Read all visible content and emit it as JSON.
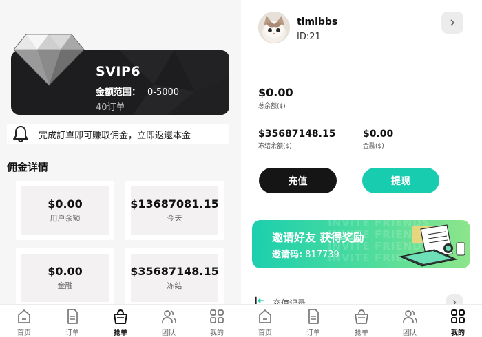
{
  "left": {
    "vip": {
      "level": "SVIP6",
      "range_label": "金额范围：",
      "range_value": "0-5000",
      "orders": "40订单"
    },
    "notice": "完成訂單即可賺取佣金，立即返還本金",
    "section_title": "佣金详情",
    "stats": [
      {
        "value": "$0.00",
        "label": "用户余额"
      },
      {
        "value": "$13687081.15",
        "label": "今天"
      },
      {
        "value": "$0.00",
        "label": "金融"
      },
      {
        "value": "$35687148.15",
        "label": "冻结"
      }
    ],
    "tabs": [
      {
        "label": "首页",
        "icon": "home-icon"
      },
      {
        "label": "订单",
        "icon": "orders-icon"
      },
      {
        "label": "抢单",
        "icon": "grab-bag-icon"
      },
      {
        "label": "团队",
        "icon": "team-icon"
      },
      {
        "label": "我的",
        "icon": "mine-grid-icon"
      }
    ],
    "active_tab": 2
  },
  "right": {
    "user": {
      "name": "timibbs",
      "id": "ID:21"
    },
    "total_balance": {
      "value": "$0.00",
      "label": "总余额($)"
    },
    "frozen_balance": {
      "value": "$35687148.15",
      "label": "冻结余额($)"
    },
    "finance": {
      "value": "$0.00",
      "label": "金融($)"
    },
    "buttons": {
      "recharge": "充值",
      "withdraw": "提现"
    },
    "invite": {
      "title": "邀请好友 获得奖励",
      "code_label": "邀请码:",
      "code": "817739",
      "ghost_text": "INVITE FRIENDS"
    },
    "recharge_record": "充值记录",
    "tabs": [
      {
        "label": "首页",
        "icon": "home-icon"
      },
      {
        "label": "订单",
        "icon": "orders-icon"
      },
      {
        "label": "抢单",
        "icon": "grab-bag-icon"
      },
      {
        "label": "团队",
        "icon": "team-icon"
      },
      {
        "label": "我的",
        "icon": "mine-grid-icon"
      }
    ],
    "active_tab": 4
  },
  "colors": {
    "accent_teal": "#18ccb0",
    "dark": "#151515",
    "card_dark": "#1d1d1f"
  }
}
